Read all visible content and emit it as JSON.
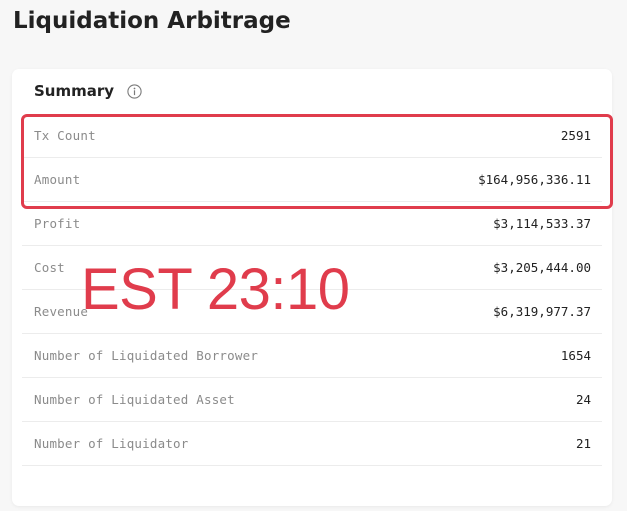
{
  "page": {
    "title": "Liquidation Arbitrage"
  },
  "summary": {
    "title": "Summary",
    "info_icon": "info-circle-icon",
    "rows": [
      {
        "label": "Tx Count",
        "value": "2591"
      },
      {
        "label": "Amount",
        "value": "$164,956,336.11"
      },
      {
        "label": "Profit",
        "value": "$3,114,533.37"
      },
      {
        "label": "Cost",
        "value": "$3,205,444.00"
      },
      {
        "label": "Revenue",
        "value": "$6,319,977.37"
      },
      {
        "label": "Number of Liquidated Borrower",
        "value": "1654"
      },
      {
        "label": "Number of Liquidated Asset",
        "value": "24"
      },
      {
        "label": "Number of Liquidator",
        "value": "21"
      }
    ]
  },
  "annotation": {
    "overlay_text": "EST 23:10",
    "color": "#e03c4c"
  }
}
